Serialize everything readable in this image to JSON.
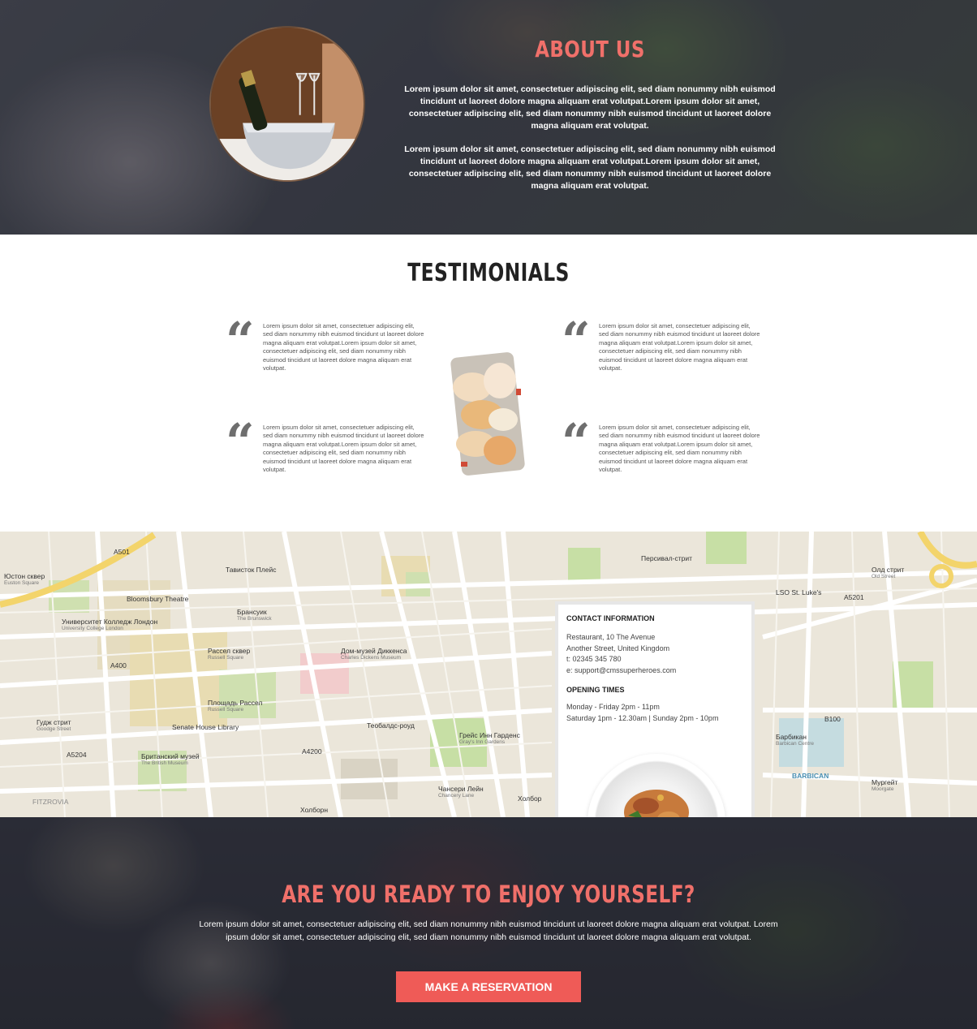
{
  "about": {
    "title": "ABOUT US",
    "paragraphs": [
      "Lorem ipsum dolor sit amet, consectetuer adipiscing elit, sed diam nonummy nibh euismod tincidunt ut laoreet dolore magna aliquam erat volutpat.Lorem ipsum dolor sit amet, consectetuer adipiscing elit, sed diam nonummy nibh euismod tincidunt ut laoreet dolore magna aliquam erat volutpat.",
      "Lorem ipsum dolor sit amet, consectetuer adipiscing elit, sed diam nonummy nibh euismod tincidunt ut laoreet dolore magna aliquam erat volutpat.Lorem ipsum dolor sit amet, consectetuer adipiscing elit, sed diam nonummy nibh euismod tincidunt ut laoreet dolore magna aliquam erat volutpat."
    ],
    "image_icon": "champagne-bucket-photo"
  },
  "testimonials": {
    "title": "TESTIMONIALS",
    "quote_glyph": "“",
    "items": [
      {
        "text": "Lorem ipsum dolor sit amet, consectetuer adipiscing elit, sed diam nonummy nibh euismod tincidunt ut laoreet dolore magna aliquam erat volutpat.Lorem ipsum dolor sit amet, consectetuer adipiscing elit, sed diam nonummy nibh euismod tincidunt ut laoreet dolore magna aliquam erat volutpat."
      },
      {
        "text": "Lorem ipsum dolor sit amet, consectetuer adipiscing elit, sed diam nonummy nibh euismod tincidunt ut laoreet dolore magna aliquam erat volutpat.Lorem ipsum dolor sit amet, consectetuer adipiscing elit, sed diam nonummy nibh euismod tincidunt ut laoreet dolore magna aliquam erat volutpat."
      },
      {
        "text": "Lorem ipsum dolor sit amet, consectetuer adipiscing elit, sed diam nonummy nibh euismod tincidunt ut laoreet dolore magna aliquam erat volutpat.Lorem ipsum dolor sit amet, consectetuer adipiscing elit, sed diam nonummy nibh euismod tincidunt ut laoreet dolore magna aliquam erat volutpat."
      },
      {
        "text": "Lorem ipsum dolor sit amet, consectetuer adipiscing elit, sed diam nonummy nibh euismod tincidunt ut laoreet dolore magna aliquam erat volutpat.Lorem ipsum dolor sit amet, consectetuer adipiscing elit, sed diam nonummy nibh euismod tincidunt ut laoreet dolore magna aliquam erat volutpat."
      }
    ],
    "center_image_icon": "bread-board-photo"
  },
  "map": {
    "labels": [
      {
        "name": "Юстон сквер",
        "sub": "Euston Square"
      },
      {
        "name": "Bloomsbury Theatre",
        "sub": ""
      },
      {
        "name": "Университет Колледж Лондон",
        "sub": "University College London"
      },
      {
        "name": "Брансуик",
        "sub": "The Brunswick"
      },
      {
        "name": "Рассел сквер",
        "sub": "Russell Square"
      },
      {
        "name": "Дом-музей Диккенса",
        "sub": "Charles Dickens Museum"
      },
      {
        "name": "Площадь Рассел",
        "sub": "Russell Square"
      },
      {
        "name": "Senate House Library",
        "sub": ""
      },
      {
        "name": "Гудж стрит",
        "sub": "Goodge Street"
      },
      {
        "name": "Британский музей",
        "sub": "The British Museum"
      },
      {
        "name": "Грейс Инн Гарденс",
        "sub": "Gray's Inn Gardens"
      },
      {
        "name": "Чансери Лейн",
        "sub": "Chancery Lane"
      },
      {
        "name": "Холборн",
        "sub": ""
      },
      {
        "name": "Олд стрит",
        "sub": "Old Street"
      },
      {
        "name": "LSO St. Luke's",
        "sub": ""
      },
      {
        "name": "Барбикан",
        "sub": "Barbican Centre"
      },
      {
        "name": "Мургейт",
        "sub": "Moorgate"
      },
      {
        "name": "BARBICAN",
        "sub": ""
      },
      {
        "name": "FITZROVIA",
        "sub": ""
      },
      {
        "name": "A501",
        "sub": ""
      },
      {
        "name": "A5201",
        "sub": ""
      },
      {
        "name": "B100",
        "sub": ""
      },
      {
        "name": "A400",
        "sub": ""
      },
      {
        "name": "A4200",
        "sub": ""
      },
      {
        "name": "A5204",
        "sub": ""
      },
      {
        "name": "Тависток Плейс",
        "sub": ""
      },
      {
        "name": "Персивал-стрит",
        "sub": ""
      },
      {
        "name": "Теобалдс-роуд",
        "sub": ""
      },
      {
        "name": "Холбор",
        "sub": ""
      }
    ],
    "contact": {
      "heading": "CONTACT INFORMATION",
      "address1": "Restaurant, 10 The Avenue",
      "address2": "Another Street, United Kingdom",
      "phone": "t: 02345 345 780",
      "email": "e: support@cmssuperheroes.com",
      "hours_heading": "OPENING TIMES",
      "hours1": "Monday - Friday 2pm - 11pm",
      "hours2": "Saturday 1pm - 12.30am | Sunday 2pm - 10pm"
    }
  },
  "cta": {
    "title": "ARE YOU READY TO ENJOY YOURSELF?",
    "text": "Lorem ipsum dolor sit amet, consectetuer adipiscing elit, sed diam nonummy nibh euismod tincidunt ut laoreet dolore magna aliquam erat volutpat. Lorem ipsum dolor sit amet, consectetuer adipiscing elit, sed diam nonummy nibh euismod tincidunt ut laoreet dolore magna aliquam erat volutpat.",
    "button": "MAKE A RESERVATION"
  },
  "colors": {
    "accent": "#f0706a",
    "button": "#ef5b57",
    "dark_bg": "#2f3039"
  }
}
